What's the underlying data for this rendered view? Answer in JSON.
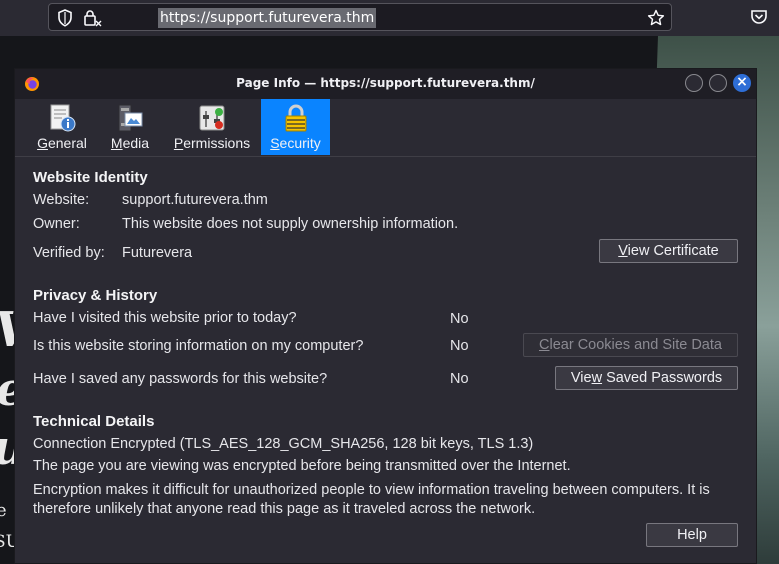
{
  "browser": {
    "url": "https://support.futurevera.thm"
  },
  "background": {
    "letters": [
      "V",
      "e",
      "u",
      "e",
      "SU"
    ]
  },
  "dialog": {
    "title": "Page Info — https://support.futurevera.thm/",
    "close_glyph": "×",
    "tabs": [
      {
        "label_u": "G",
        "label_rest": "eneral",
        "icon": "general-info-icon",
        "selected": false
      },
      {
        "label_u": "M",
        "label_rest": "edia",
        "icon": "media-icon",
        "selected": false
      },
      {
        "label_u": "P",
        "label_rest": "ermissions",
        "icon": "permissions-icon",
        "selected": false
      },
      {
        "label_u": "S",
        "label_rest": "ecurity",
        "icon": "lock-icon",
        "selected": true
      }
    ],
    "identity": {
      "heading": "Website Identity",
      "website_label": "Website:",
      "website_value": "support.futurevera.thm",
      "owner_label": "Owner:",
      "owner_value": "This website does not supply ownership information.",
      "verified_label": "Verified by:",
      "verified_value": "Futurevera",
      "view_cert_u": "V",
      "view_cert_rest": "iew Certificate"
    },
    "privacy": {
      "heading": "Privacy & History",
      "q_visited": "Have I visited this website prior to today?",
      "a_visited": "No",
      "q_storing": "Is this website storing information on my computer?",
      "a_storing": "No",
      "clear_u": "C",
      "clear_rest": "lear Cookies and Site Data",
      "q_passwords": "Have I saved any passwords for this website?",
      "a_passwords": "No",
      "view_pw_pre": "Vie",
      "view_pw_u": "w",
      "view_pw_rest": " Saved Passwords"
    },
    "technical": {
      "heading": "Technical Details",
      "line1": "Connection Encrypted (TLS_AES_128_GCM_SHA256, 128 bit keys, TLS 1.3)",
      "line2": "The page you are viewing was encrypted before being transmitted over the Internet.",
      "line3a": "Encryption makes it difficult for unauthorized people to view information traveling between computers. It is",
      "line3b": "therefore unlikely that anyone read this page as it traveled across the network.",
      "help": "Help"
    }
  },
  "colors": {
    "accent": "#0a84ff",
    "close_button": "#2e6ed6"
  }
}
